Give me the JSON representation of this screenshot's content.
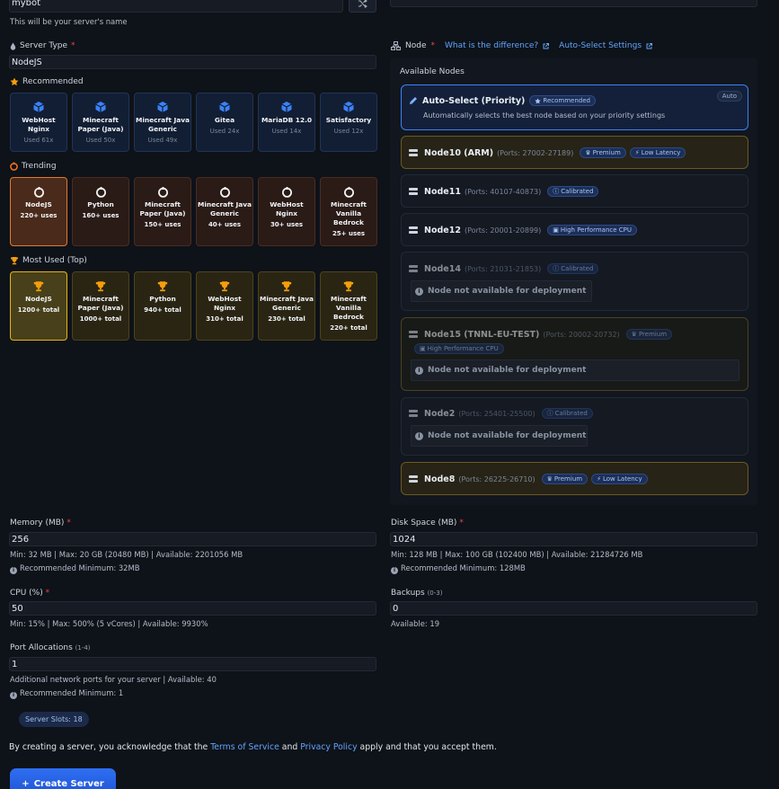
{
  "server_name": {
    "value": "mybot",
    "hint": "This will be your server's name"
  },
  "server_type": {
    "label": "Server Type",
    "required": "*",
    "value": "NodeJS",
    "recommended": {
      "title": "Recommended",
      "items": [
        {
          "name": "WebHost Nginx",
          "sub": "Used 61x"
        },
        {
          "name": "Minecraft Paper (Java)",
          "sub": "Used 50x"
        },
        {
          "name": "Minecraft Java Generic",
          "sub": "Used 49x"
        },
        {
          "name": "Gitea",
          "sub": "Used 24x"
        },
        {
          "name": "MariaDB 12.0",
          "sub": "Used 14x"
        },
        {
          "name": "Satisfactory",
          "sub": "Used 12x"
        }
      ]
    },
    "trending": {
      "title": "Trending",
      "items": [
        {
          "name": "NodeJS",
          "sub": "220+ uses"
        },
        {
          "name": "Python",
          "sub": "160+ uses"
        },
        {
          "name": "Minecraft Paper (Java)",
          "sub": "150+ uses"
        },
        {
          "name": "Minecraft Java Generic",
          "sub": "40+ uses"
        },
        {
          "name": "WebHost Nginx",
          "sub": "30+ uses"
        },
        {
          "name": "Minecraft Vanilla Bedrock",
          "sub": "25+ uses"
        }
      ]
    },
    "most_used": {
      "title": "Most Used (Top)",
      "items": [
        {
          "name": "NodeJS",
          "sub": "1200+ total"
        },
        {
          "name": "Minecraft Paper (Java)",
          "sub": "1000+ total"
        },
        {
          "name": "Python",
          "sub": "940+ total"
        },
        {
          "name": "WebHost Nginx",
          "sub": "310+ total"
        },
        {
          "name": "Minecraft Java Generic",
          "sub": "230+ total"
        },
        {
          "name": "Minecraft Vanilla Bedrock",
          "sub": "220+ total"
        }
      ]
    }
  },
  "node": {
    "label": "Node",
    "required": "*",
    "diff_link": "What is the difference?",
    "auto_link": "Auto-Select Settings",
    "available_title": "Available Nodes",
    "auto_select": {
      "title": "Auto-Select (Priority)",
      "badge": "Recommended",
      "tag": "Auto",
      "desc": "Automatically selects the best node based on your priority settings"
    },
    "not_available": "Node not available for deployment",
    "nodes": [
      {
        "name": "Node10 (ARM)",
        "ports": "(Ports: 27002-27189)",
        "badges": [
          "Premium",
          "Low Latency"
        ]
      },
      {
        "name": "Node11",
        "ports": "(Ports: 40107-40873)",
        "badges": [
          "Calibrated"
        ]
      },
      {
        "name": "Node12",
        "ports": "(Ports: 20001-20899)",
        "badges": [
          "High Performance CPU"
        ]
      },
      {
        "name": "Node14",
        "ports": "(Ports: 21031-21853)",
        "badges": [
          "Calibrated"
        ]
      },
      {
        "name": "Node15 (TNNL-EU-TEST)",
        "ports": "(Ports: 20002-20732)",
        "badges": [
          "Premium",
          "High Performance CPU"
        ]
      },
      {
        "name": "Node2",
        "ports": "(Ports: 25401-25500)",
        "badges": [
          "Calibrated"
        ]
      },
      {
        "name": "Node8",
        "ports": "(Ports: 26225-26710)",
        "badges": [
          "Premium",
          "Low Latency"
        ]
      }
    ]
  },
  "memory": {
    "label": "Memory (MB)",
    "required": "*",
    "value": "256",
    "limits": "Min: 32 MB | Max: 20 GB (20480 MB) | Available: 2201056 MB",
    "recommended": "Recommended Minimum: 32MB"
  },
  "disk": {
    "label": "Disk Space (MB)",
    "required": "*",
    "value": "1024",
    "limits": "Min: 128 MB | Max: 100 GB (102400 MB) | Available: 21284726 MB",
    "recommended": "Recommended Minimum: 128MB"
  },
  "cpu": {
    "label": "CPU (%)",
    "required": "*",
    "value": "50",
    "limits": "Min: 15% | Max: 500% (5 vCores) | Available: 9930%"
  },
  "backups": {
    "label": "Backups",
    "range": "(0-3)",
    "value": "0",
    "available": "Available: 19"
  },
  "ports": {
    "label": "Port Allocations",
    "range": "(1-4)",
    "value": "1",
    "hint": "Additional network ports for your server | Available: 40",
    "recommended": "Recommended Minimum: 1"
  },
  "server_slots": "Server Slots: 18",
  "terms": {
    "pre": "By creating a server, you acknowledge that the ",
    "tos": "Terms of Service",
    "and": " and ",
    "privacy": "Privacy Policy",
    "post": " apply and that you accept them."
  },
  "create_button": "Create Server",
  "colors": {
    "accent": "#3b82f6",
    "trending": "#e07a2e",
    "gold": "#e2b416",
    "required": "#ef4444"
  }
}
